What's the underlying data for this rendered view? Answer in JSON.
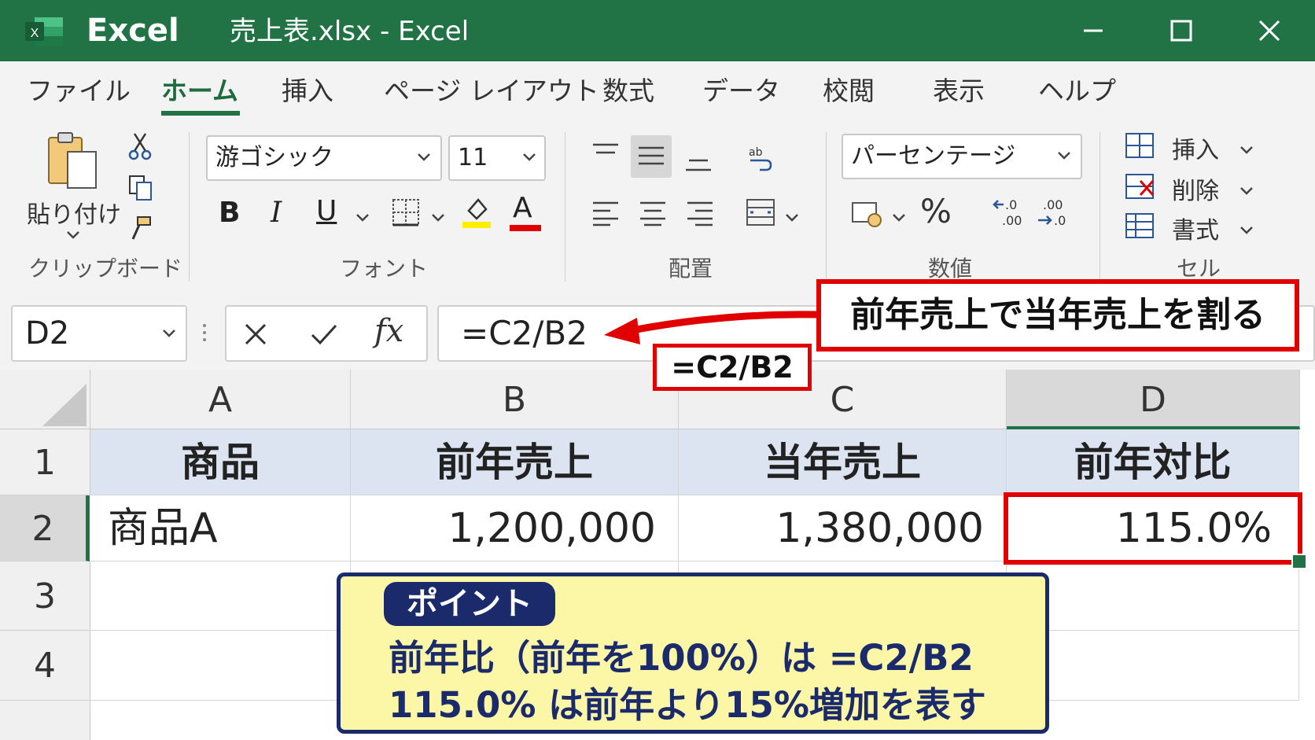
{
  "window": {
    "app_name": "Excel",
    "document_title": "売上表.xlsx  -  Excel",
    "logo_letter": "X"
  },
  "menu": {
    "tabs": [
      {
        "label": "ファイル"
      },
      {
        "label": "ホーム",
        "active": true
      },
      {
        "label": "挿入"
      },
      {
        "label": "ページ レイアウト"
      },
      {
        "label": "数式"
      },
      {
        "label": "データ"
      },
      {
        "label": "校閲"
      },
      {
        "label": "表示"
      },
      {
        "label": "ヘルプ"
      }
    ]
  },
  "ribbon": {
    "clipboard": {
      "paste_label": "貼り付け",
      "group_label": "クリップボード"
    },
    "font": {
      "font_name": "游ゴシック",
      "font_size": "11",
      "bold": "B",
      "italic": "I",
      "underline": "U",
      "font_color_letter": "A",
      "group_label": "フォント"
    },
    "alignment": {
      "group_label": "配置"
    },
    "number": {
      "format": "パーセンテージ",
      "percent": "%",
      "group_label": "数値"
    },
    "cells": {
      "insert": "挿入",
      "delete": "削除",
      "format": "書式",
      "group_label": "セル"
    }
  },
  "formula_bar": {
    "name_box": "D2",
    "formula": "=C2/B2",
    "fx": "fx"
  },
  "sheet": {
    "columns": [
      "A",
      "B",
      "C",
      "D"
    ],
    "rows": [
      "1",
      "2",
      "3",
      "4"
    ],
    "header_row": [
      "商品",
      "前年売上",
      "当年売上",
      "前年対比"
    ],
    "data_row": [
      "商品A",
      "1,200,000",
      "1,380,000",
      "115.0%"
    ]
  },
  "annotations": {
    "callout": "前年売上で当年売上を割る",
    "formula_label": "=C2/B2",
    "point_badge": "ポイント",
    "point_line1": "前年比（前年を100%）は =C2/B2",
    "point_line2": "115.0% は前年より15%増加を表す"
  },
  "colors": {
    "title_bar": "#217346",
    "header_fill": "#dce3f1",
    "highlight_red": "#e00000",
    "point_fill": "#fbf7a6",
    "point_navy": "#1b2a6b"
  }
}
